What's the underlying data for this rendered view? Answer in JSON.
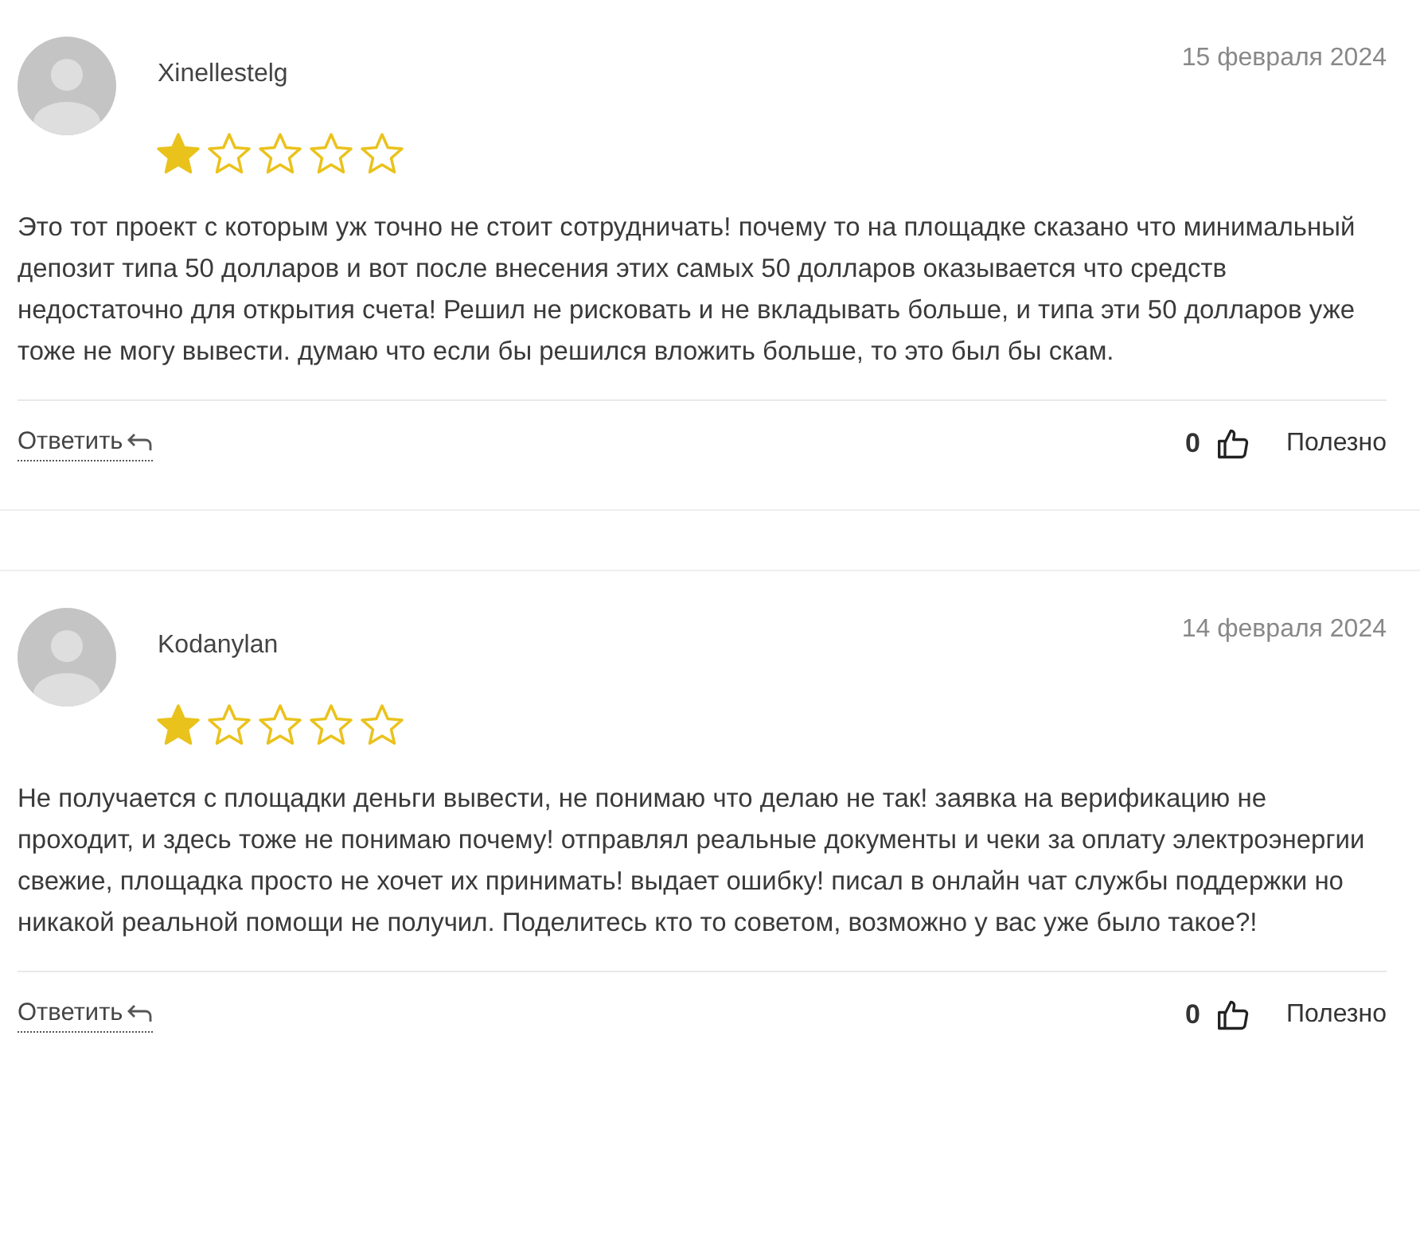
{
  "reviews": [
    {
      "author": "Xinellestelg",
      "date": "15 февраля 2024",
      "stars": 1,
      "text": "Это тот проект с которым уж точно не стоит сотрудничать! почему то на площадке сказано что минимальный депозит типа 50 долларов и вот после внесения этих самых 50 долларов оказывается что средств недостаточно для открытия счета! Решил не рисковать и не вкладывать больше, и типа эти 50 долларов уже тоже не могу вывести. думаю что если бы решился вложить больше, то это был бы скам.",
      "reply": "Ответить",
      "likes": "0",
      "helpful": "Полезно"
    },
    {
      "author": "Kodanylan",
      "date": "14 февраля 2024",
      "stars": 1,
      "text": "Не получается с площадки деньги вывести, не понимаю что делаю не так! заявка на верификацию не проходит, и здесь тоже не понимаю почему! отправлял реальные документы и чеки за оплату электроэнергии свежие, площадка просто не хочет их принимать! выдает ошибку! писал в онлайн чат службы поддержки но никакой реальной помощи не получил. Поделитесь кто то советом, возможно у вас уже было такое?!",
      "reply": "Ответить",
      "likes": "0",
      "helpful": "Полезно"
    }
  ]
}
